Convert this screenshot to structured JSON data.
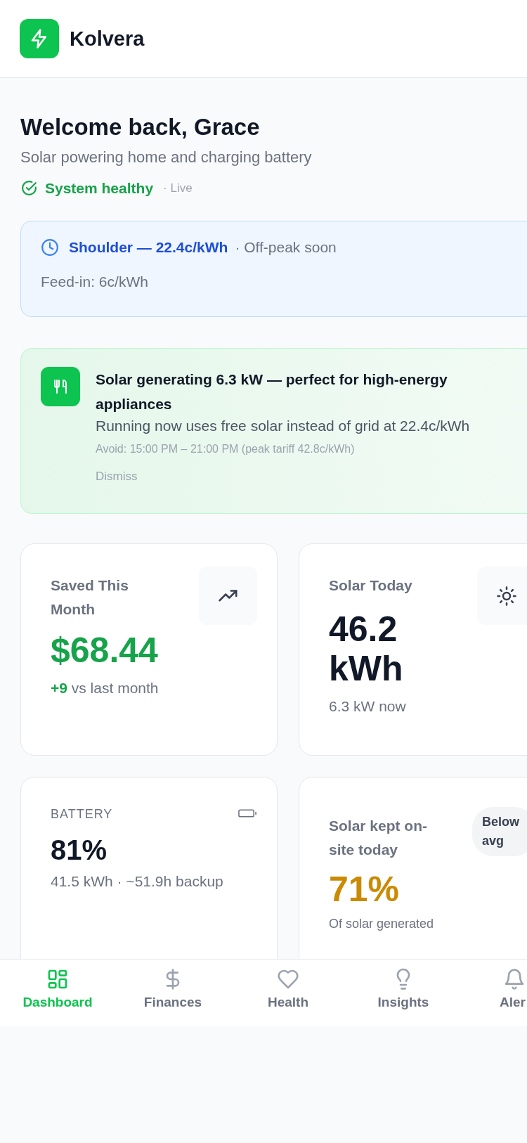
{
  "app": {
    "name": "Kolvera"
  },
  "welcome": {
    "title": "Welcome back, Grace",
    "subtitle": "Solar powering home and charging battery",
    "status": "System healthy",
    "live": "· Live"
  },
  "tariff": {
    "rate": "Shoulder — 22.4c/kWh",
    "note": "· Off-peak soon",
    "feed_in": "Feed-in: 6c/kWh"
  },
  "suggestion": {
    "title": "Solar generating 6.3 kW — perfect for high-energy appliances",
    "body": "Running now uses free solar instead of grid at 22.4c/kWh",
    "avoid": "Avoid: 15:00 PM – 21:00 PM (peak tariff 42.8c/kWh)",
    "dismiss": "Dismiss"
  },
  "cards": [
    {
      "kind": "savings",
      "label": "Saved This Month",
      "value": "$68.44",
      "delta": "+9",
      "delta_text": "vs last month"
    },
    {
      "kind": "solar",
      "label": "Solar Today",
      "value": "46.2 kWh",
      "sub": "6.3 kW now"
    },
    {
      "kind": "battery",
      "label": "BATTERY",
      "value": "81%",
      "sub": "41.5 kWh · ~51.9h backup"
    },
    {
      "kind": "self_use",
      "label": "Solar kept on-site today",
      "badge": "Below avg",
      "value": "71%",
      "sub": "Of solar generated"
    }
  ],
  "nav": [
    {
      "label": "Dashboard",
      "selected": true
    },
    {
      "label": "Finances",
      "selected": false
    },
    {
      "label": "Health",
      "selected": false
    },
    {
      "label": "Insights",
      "selected": false
    },
    {
      "label": "Aler",
      "selected": false
    }
  ]
}
